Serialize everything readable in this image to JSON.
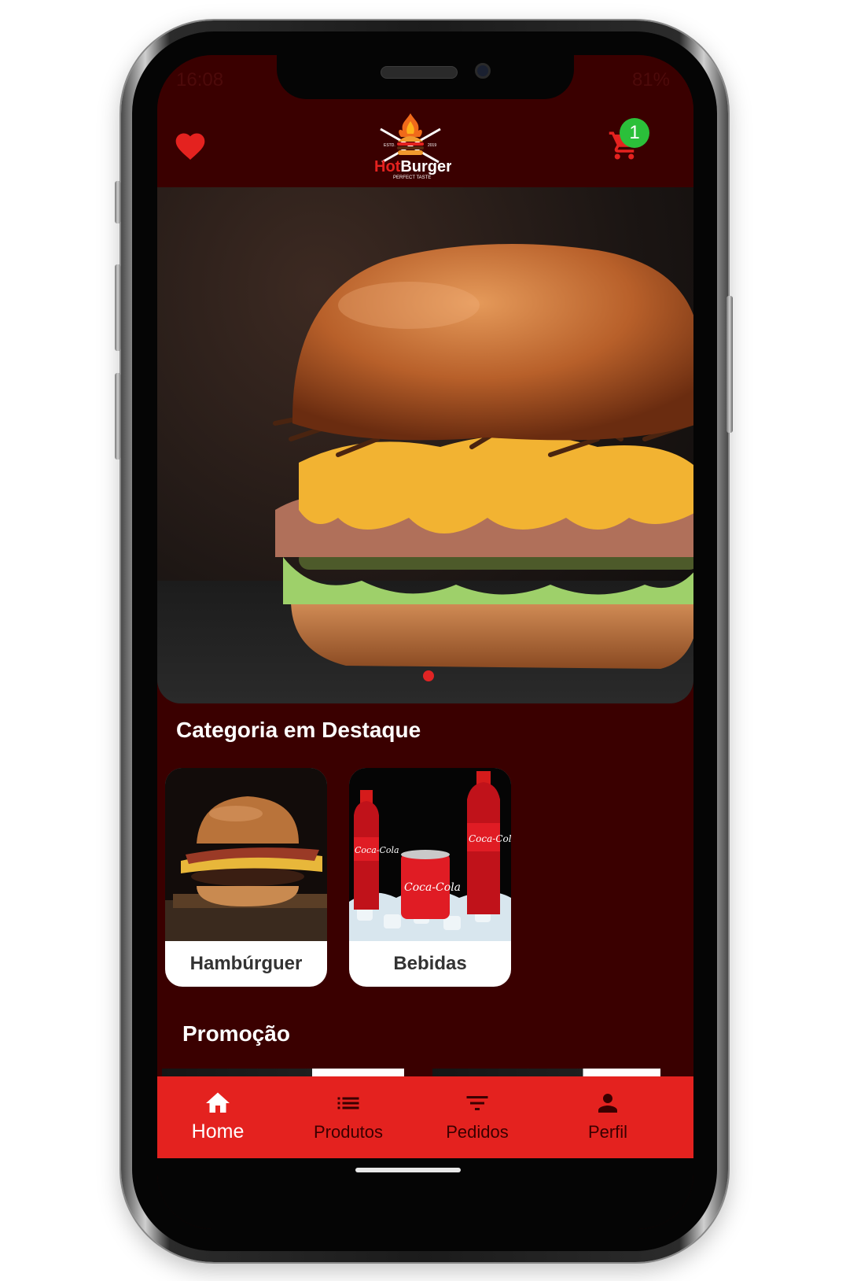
{
  "status_bar": {
    "time": "16:08",
    "battery": "81%"
  },
  "header": {
    "logo_text": "HotBurger",
    "logo_tagline": "PERFECT TASTE",
    "cart_count": "1"
  },
  "sections": {
    "featured_categories_title": "Categoria em Destaque",
    "promotion_title": "Promoção"
  },
  "categories": [
    {
      "label": "Hambúrguer"
    },
    {
      "label": "Bebidas"
    }
  ],
  "bottom_nav": [
    {
      "label": "Home",
      "icon": "home-icon",
      "active": true
    },
    {
      "label": "Produtos",
      "icon": "list-icon",
      "active": false
    },
    {
      "label": "Pedidos",
      "icon": "filter-icon",
      "active": false
    },
    {
      "label": "Perfil",
      "icon": "person-icon",
      "active": false
    }
  ],
  "colors": {
    "background": "#3a0000",
    "accent": "#e4221f",
    "badge": "#2bc03a"
  }
}
